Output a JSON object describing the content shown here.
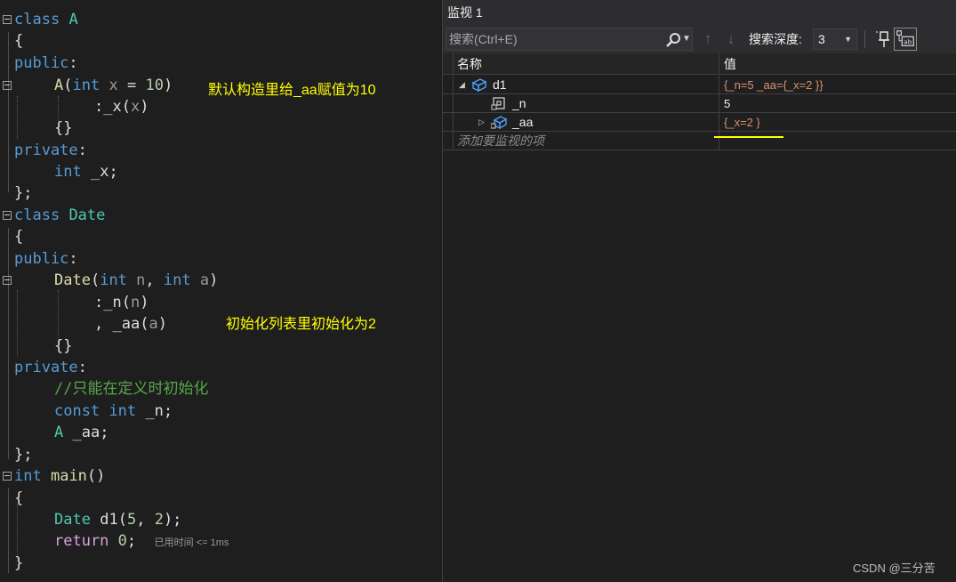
{
  "editor": {
    "annotations": {
      "ctor_note": "默认构造里给_aa赋值为10",
      "init_note": "初始化列表里初始化为2"
    },
    "timing_hint": "已用时间 <= 1ms",
    "tokens": {
      "class": "class",
      "A": "A",
      "Date": "Date",
      "public": "public",
      "private": "private",
      "int": "int",
      "const": "const",
      "return": "return",
      "main": "main",
      "d1": "d1",
      "x": "x",
      "n": "n",
      "a": "a",
      "_x": "_x",
      "_n": "_n",
      "_aa": "_aa",
      "num10": "10",
      "num5": "5",
      "num2": "2",
      "num0": "0",
      "comment": "//只能在定义时初始化"
    }
  },
  "watch": {
    "title": "监视 1",
    "search_placeholder": "搜索(Ctrl+E)",
    "depth_label": "搜索深度:",
    "depth_value": "3",
    "columns": {
      "name": "名称",
      "value": "值"
    },
    "rows": [
      {
        "name": "d1",
        "value": "{_n=5 _aa={_x=2 }}"
      },
      {
        "name": "_n",
        "value": "5"
      },
      {
        "name": "_aa",
        "value": "{_x=2 }"
      }
    ],
    "add_item_placeholder": "添加要监视的项"
  },
  "watermark": "CSDN @三分苦",
  "colors": {
    "annotation": "#ffff00",
    "keyword": "#569cd6",
    "type": "#4ec9b0",
    "comment": "#57a64a",
    "object_value": "#d6936f"
  }
}
